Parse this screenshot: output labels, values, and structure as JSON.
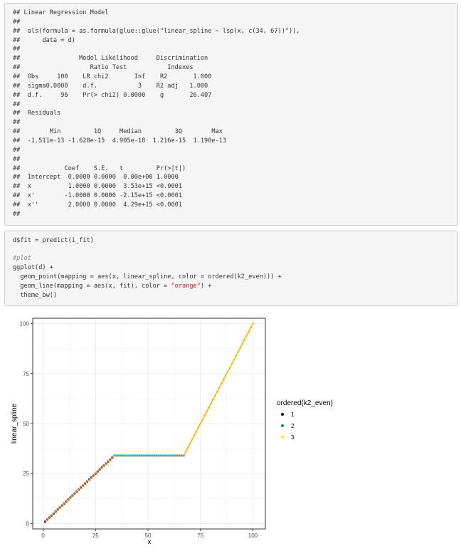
{
  "console_output": {
    "lines": [
      "## Linear Regression Model",
      "##",
      "##  ols(formula = as.formula(glue::glue(\"linear_spline ~ lsp(x, c(34, 67))\")),",
      "##      data = d)",
      "##",
      "##                Model Likelihood     Discrimination",
      "##                   Ratio Test           Indexes",
      "##  Obs     100    LR chi2       Inf    R2       1.000",
      "##  sigma0.0000    d.f.           3    R2 adj   1.000",
      "##  d.f.     96    Pr(> chi2) 0.0000    g       26.407",
      "##",
      "##  Residuals",
      "##",
      "##        Min         1Q     Median         3Q        Max",
      "##  -1.511e-13 -1.628e-15  4.905e-18  1.216e-15  1.190e-13",
      "##",
      "##",
      "##            Coef    S.E.   t         Pr(>|t|)",
      "##  Intercept  0.0000 0.0000  0.00e+00 1.0000",
      "##  x          1.0000 0.0000  3.53e+15 <0.0001",
      "##  x'        -1.0000 0.0000 -2.15e+15 <0.0001",
      "##  x''        2.0000 0.0000  4.29e+15 <0.0001",
      "##"
    ]
  },
  "code": {
    "line1": "d$fit = predict(i_fit)",
    "comment": "#plot",
    "line3": "ggplot(d) +",
    "line4": "  geom_point(mapping = aes(x, linear_spline, color = ordered(k2_even))) +",
    "line5_pre": "  geom_line(mapping = aes(x, fit), color = ",
    "line5_str": "\"orange\"",
    "line5_post": ") +",
    "line6": "  theme_bw()"
  },
  "chart_data": {
    "type": "scatter",
    "xlabel": "x",
    "ylabel": "linear_spline",
    "xlim": [
      -4.95,
      105.95
    ],
    "ylim": [
      -2.7,
      102.7
    ],
    "x_ticks": [
      0,
      25,
      50,
      75,
      100
    ],
    "y_ticks": [
      0,
      25,
      50,
      75,
      100
    ],
    "grid": true,
    "legend": {
      "title": "ordered(k2_even)",
      "placement": "right",
      "entries": [
        {
          "label": "1",
          "color": "#440154"
        },
        {
          "label": "2",
          "color": "#21908C"
        },
        {
          "label": "3",
          "color": "#FDE725"
        }
      ]
    },
    "knots": [
      34,
      67
    ],
    "series": [
      {
        "name": "1",
        "x_range": [
          1,
          33
        ],
        "color": "#440154"
      },
      {
        "name": "2",
        "x_range": [
          34,
          67
        ],
        "color": "#21908C"
      },
      {
        "name": "3",
        "x_range": [
          68,
          100
        ],
        "color": "#FDE725"
      }
    ],
    "fit_line": {
      "color": "#FFA500",
      "points": [
        [
          1,
          1
        ],
        [
          34,
          34
        ],
        [
          67,
          34
        ],
        [
          100,
          100
        ]
      ]
    }
  }
}
